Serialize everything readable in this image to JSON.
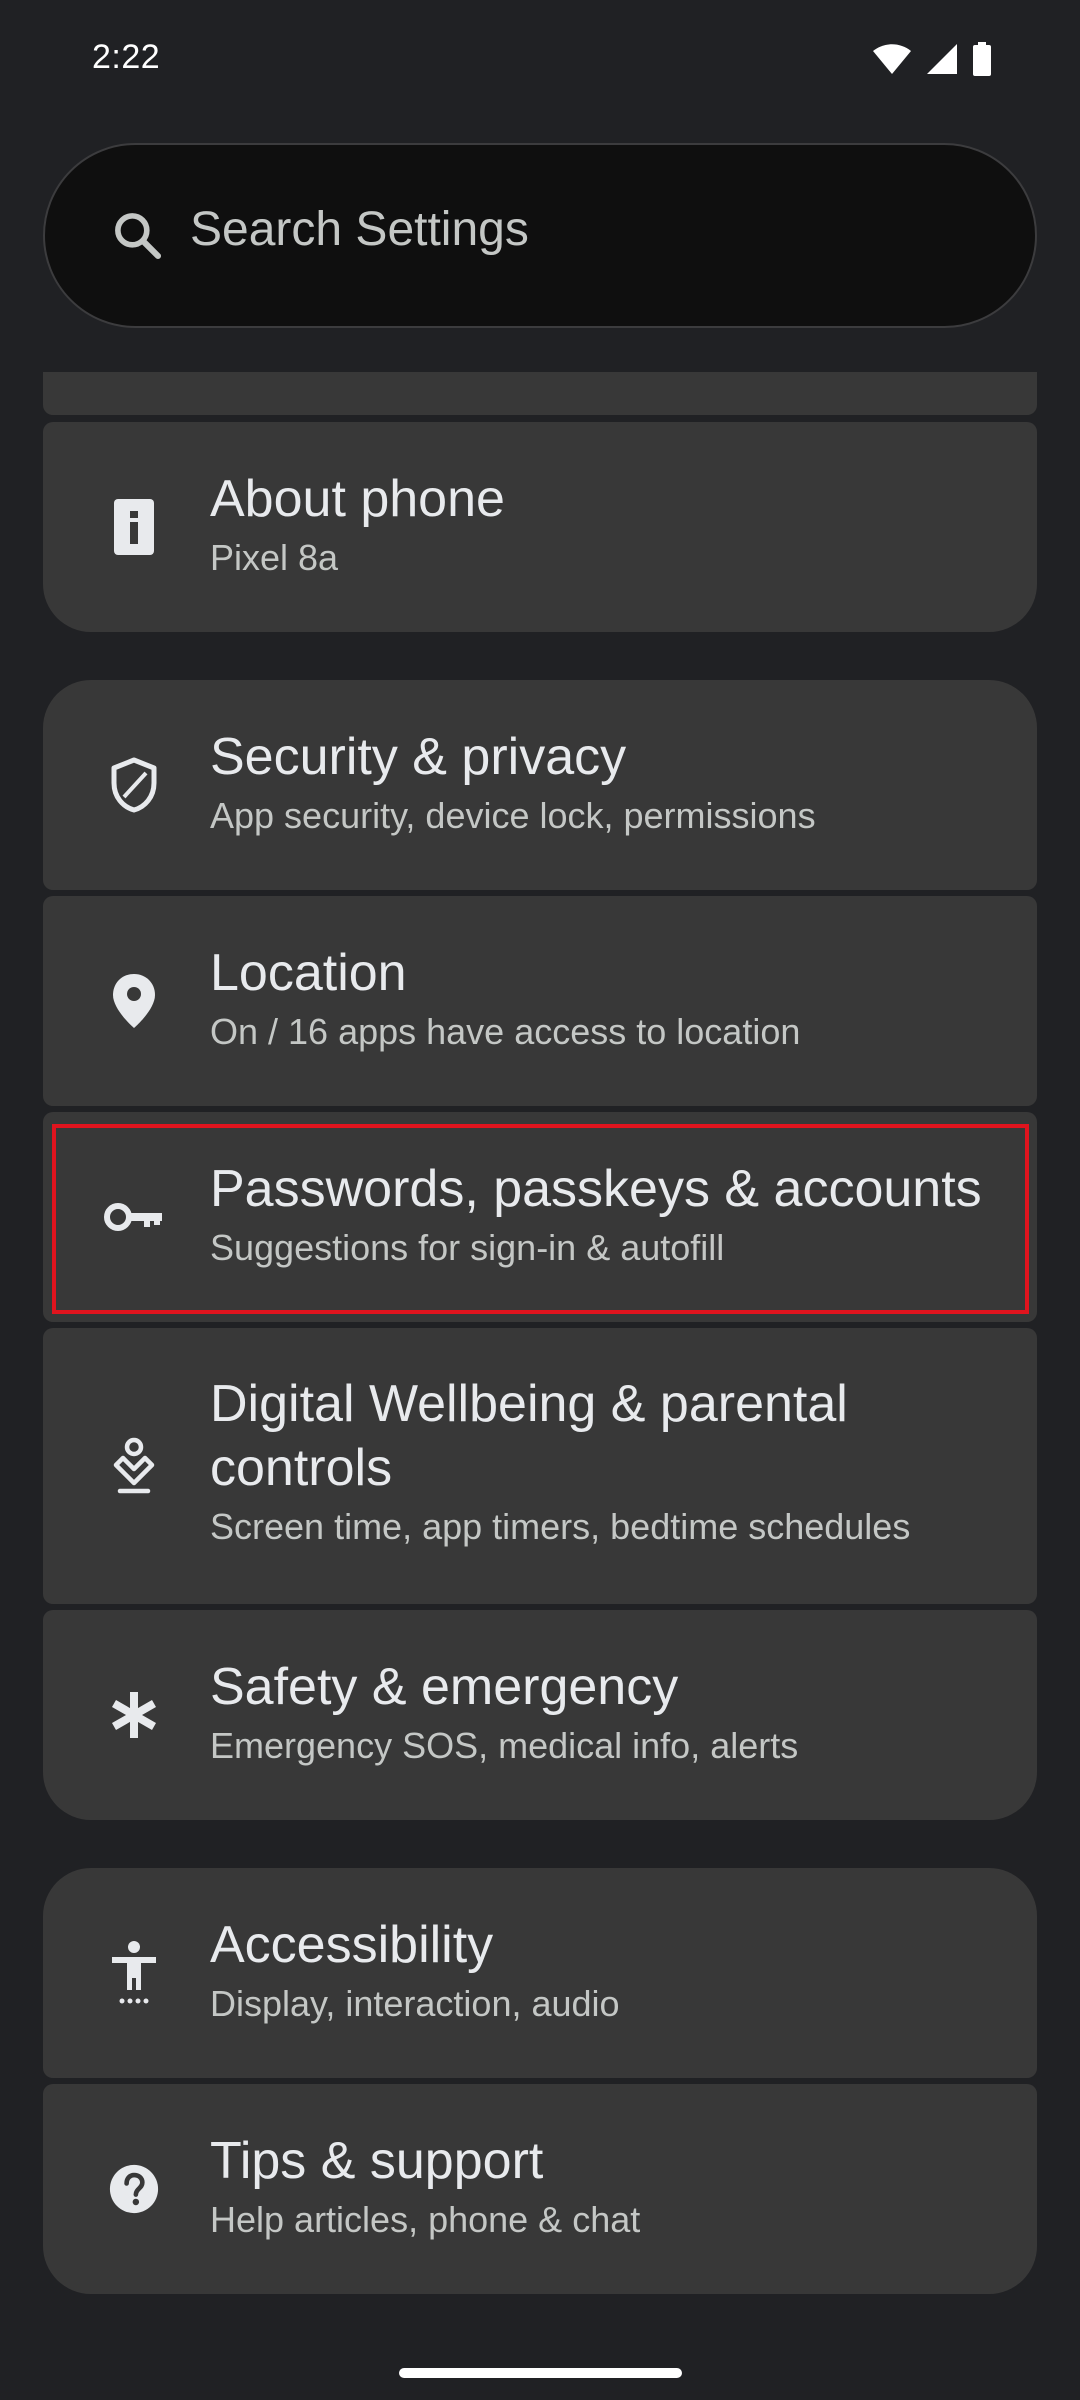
{
  "status_bar": {
    "time": "2:22",
    "icons": [
      "wifi-icon",
      "cellular-signal-icon",
      "battery-icon"
    ]
  },
  "search": {
    "placeholder": "Search Settings",
    "icon": "search-icon"
  },
  "settings_items": [
    {
      "id": "about-phone",
      "icon": "info-icon",
      "title": "About phone",
      "subtitle": "Pixel 8a"
    },
    {
      "id": "security-privacy",
      "icon": "shield-icon",
      "title": "Security & privacy",
      "subtitle": "App security, device lock, permissions"
    },
    {
      "id": "location",
      "icon": "location-pin-icon",
      "title": "Location",
      "subtitle": "On / 16 apps have access to location"
    },
    {
      "id": "passwords-accounts",
      "icon": "key-icon",
      "title": "Passwords, passkeys & accounts",
      "subtitle": "Suggestions for sign-in & autofill",
      "highlighted": true
    },
    {
      "id": "digital-wellbeing",
      "icon": "wellbeing-icon",
      "title_line1": "Digital Wellbeing & parental",
      "title_line2": "controls",
      "subtitle": "Screen time, app timers, bedtime schedules"
    },
    {
      "id": "safety-emergency",
      "icon": "asterisk-icon",
      "title": "Safety & emergency",
      "subtitle": "Emergency SOS, medical info, alerts"
    },
    {
      "id": "accessibility",
      "icon": "accessibility-icon",
      "title": "Accessibility",
      "subtitle": "Display, interaction, audio"
    },
    {
      "id": "tips-support",
      "icon": "help-icon",
      "title": "Tips & support",
      "subtitle": "Help articles, phone & chat"
    }
  ],
  "colors": {
    "background": "#202124",
    "card": "#383838",
    "search_background": "#0f0f0f",
    "highlight": "#e0141e",
    "text_primary": "#e8eaed",
    "text_secondary": "#c4c7c5"
  }
}
